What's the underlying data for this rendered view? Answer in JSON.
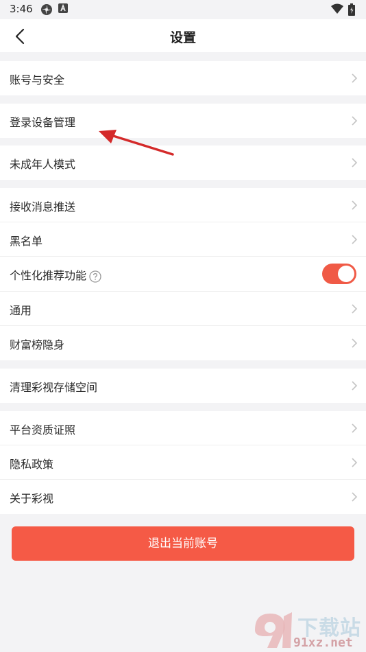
{
  "status_bar": {
    "time": "3:46"
  },
  "header": {
    "title": "设置"
  },
  "items": [
    {
      "label": "账号与安全"
    },
    {
      "label": "登录设备管理"
    },
    {
      "label": "未成年人模式"
    },
    {
      "label": "接收消息推送"
    },
    {
      "label": "黑名单"
    },
    {
      "label": "个性化推荐功能",
      "toggle_on": true
    },
    {
      "label": "通用"
    },
    {
      "label": "财富榜隐身"
    },
    {
      "label": "清理彩视存储空间"
    },
    {
      "label": "平台资质证照"
    },
    {
      "label": "隐私政策"
    },
    {
      "label": "关于彩视"
    }
  ],
  "logout_label": "退出当前账号",
  "watermark": {
    "text": "下载站",
    "url": "91xz.net"
  },
  "colors": {
    "accent": "#f55a46",
    "annotation_arrow": "#d42a2a"
  }
}
